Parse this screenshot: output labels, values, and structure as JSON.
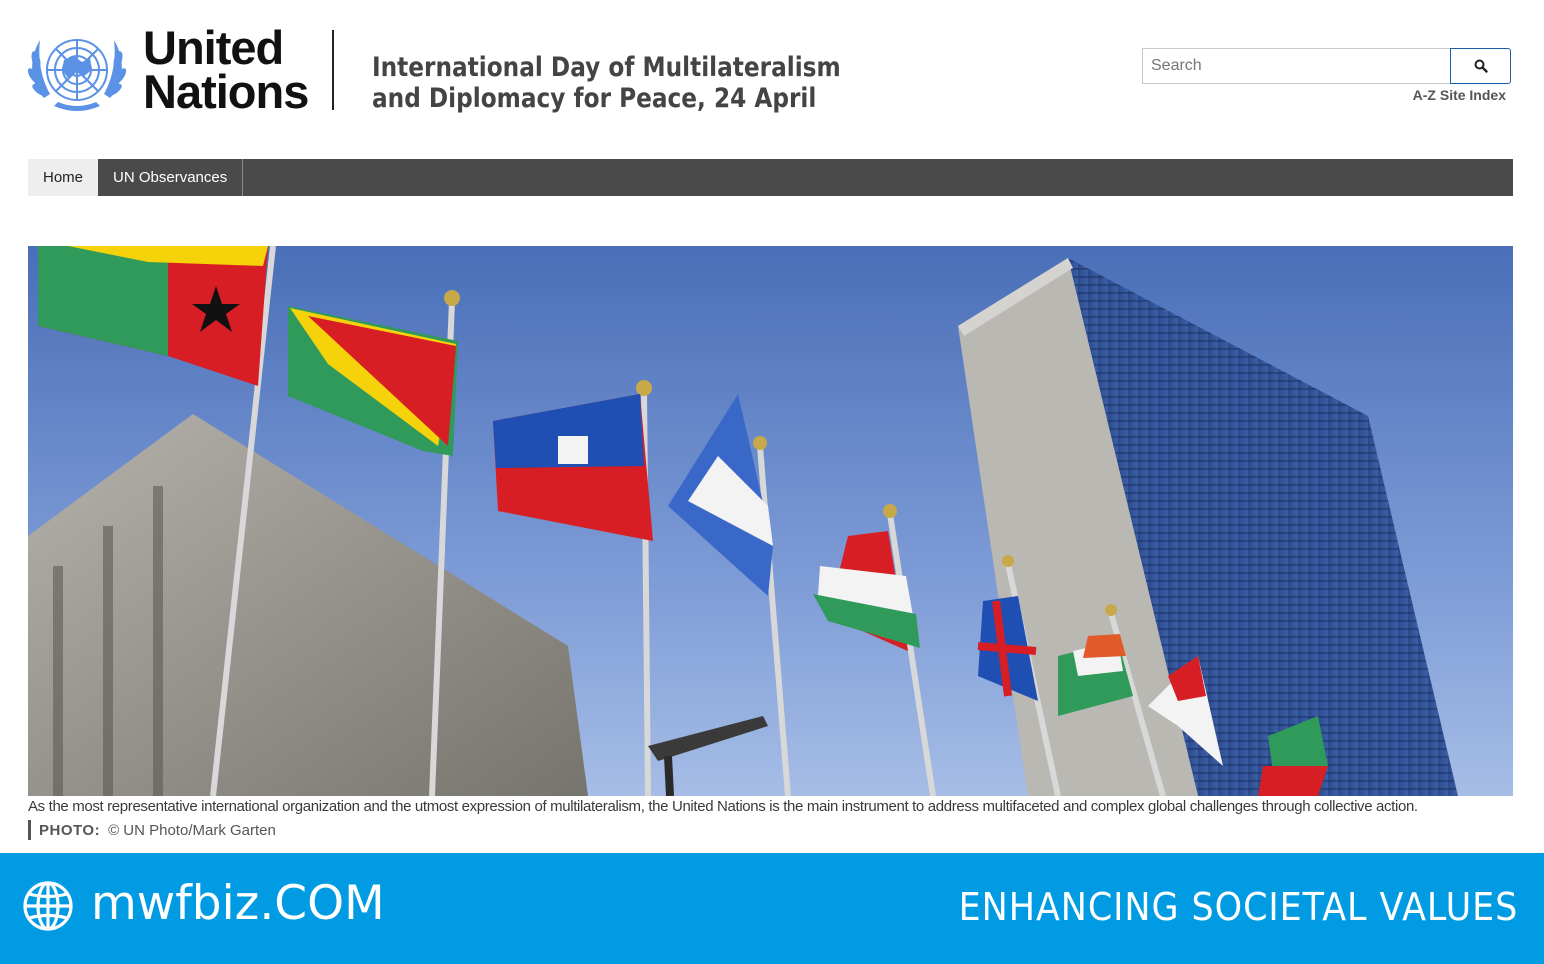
{
  "header": {
    "org_name_line1": "United",
    "org_name_line2": "Nations",
    "page_title": "International Day of Multilateralism and Diplomacy for Peace, 24 April",
    "search_placeholder": "Search",
    "az_index_label": "A-Z Site Index"
  },
  "nav": {
    "items": [
      {
        "label": "Home",
        "active": true
      },
      {
        "label": "UN Observances",
        "active": false
      }
    ]
  },
  "hero": {
    "caption": "As the most representative international organization and the utmost expression of multilateralism, the United Nations is the main instrument to address multifaceted and complex global challenges through collective action.",
    "credit_label": "PHOTO:",
    "credit_value": "© UN Photo/Mark Garten"
  },
  "banner": {
    "site_name": "mwfbiz.COM",
    "tagline": "ENHANCING SOCIETAL VALUES",
    "icon": "globe-icon"
  },
  "colors": {
    "un_blue": "#5b92e5",
    "nav_bg": "#4a4a4a",
    "banner_bg": "#019be4"
  }
}
